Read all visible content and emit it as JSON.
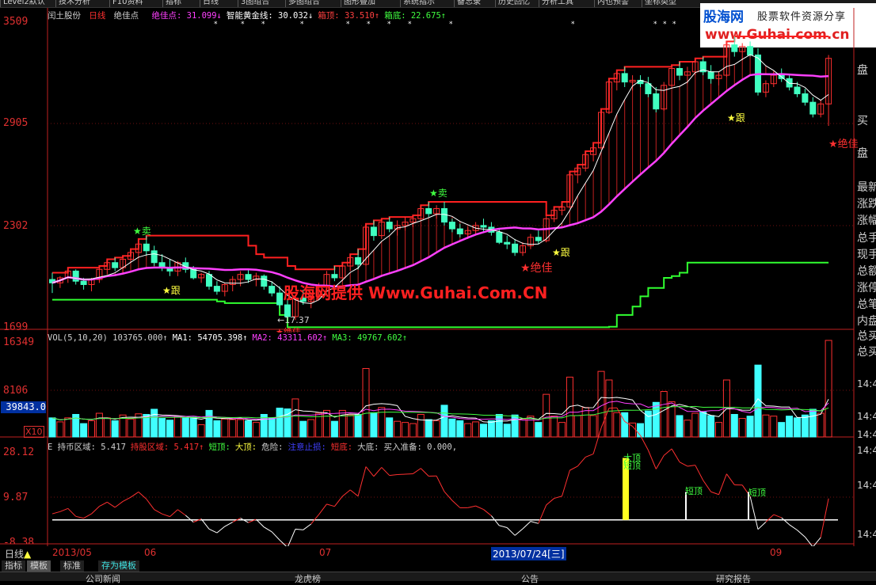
{
  "menubar": {
    "items": [
      "Level2默认",
      "技术分析",
      "F10资料",
      "指标",
      "日线",
      "3图组合",
      "多图组合",
      "图形叠加",
      "系统指示",
      "备忘录",
      "历史回忆",
      "分析工具",
      "内也预警",
      "坐标类型"
    ]
  },
  "logo": {
    "brand": "股海网",
    "slogan": "股票软件资源分享",
    "url": "www.Guhai.com.cn"
  },
  "watermark": "股海网提供 Www.Guhai.Com.CN",
  "stock": {
    "name": "闰土股份",
    "period": "日线",
    "indicator": "绝佳点"
  },
  "main_legend": [
    {
      "text": "绝佳点: 31.099↓",
      "color": "#ff40ff"
    },
    {
      "text": "智能黄金线: 30.032↓",
      "color": "#ffffff"
    },
    {
      "text": "箱顶: 33.510↑",
      "color": "#ff4040"
    },
    {
      "text": "箱底: 22.675↑",
      "color": "#40ff40"
    }
  ],
  "price_axis": [
    "3509",
    "2905",
    "2302",
    "1699"
  ],
  "price_low_label": "←17.37",
  "signals": [
    {
      "text": "★卖",
      "color": "#40ff40"
    },
    {
      "text": "★跟",
      "color": "#ffff40"
    },
    {
      "text": "★卖",
      "color": "#40ff40"
    },
    {
      "text": "★跟",
      "color": "#ffff40"
    },
    {
      "text": "★绝佳",
      "color": "#ff3030"
    },
    {
      "text": "★跟",
      "color": "#ffff40"
    },
    {
      "text": "★绝佳",
      "color": "#ff3030"
    },
    {
      "text": "★绝佳",
      "color": "#ff3030"
    }
  ],
  "volume": {
    "legend": [
      {
        "text": "VOL(5,10,20) 103765.000↑",
        "color": "#d0d0d0"
      },
      {
        "text": "MA1: 54705.398↑",
        "color": "#ffffff"
      },
      {
        "text": "MA2: 43311.602↑",
        "color": "#ff40ff"
      },
      {
        "text": "MA3: 49767.602↑",
        "color": "#40ff40"
      }
    ],
    "axis": [
      "16349",
      "8106"
    ],
    "current": "39843.0",
    "unit": "X10"
  },
  "lower": {
    "legend": [
      {
        "text": "E 持币区域: 5.417",
        "color": "#d0d0d0"
      },
      {
        "text": "持股区域: 5.417↑",
        "color": "#ff3030"
      },
      {
        "text": "短顶:",
        "color": "#40ff40"
      },
      {
        "text": "大顶:",
        "color": "#ffff40"
      },
      {
        "text": "危险:",
        "color": "#d0d0d0"
      },
      {
        "text": "注意止损:",
        "color": "#4040ff"
      },
      {
        "text": "短底:",
        "color": "#ff3030"
      },
      {
        "text": "大底:",
        "color": "#d0d0d0"
      },
      {
        "text": "买入准备: 0.000,",
        "color": "#d0d0d0"
      }
    ],
    "axis": [
      "28.12",
      "9.87",
      "-8.38"
    ],
    "top_labels": [
      "大顶",
      "短顶",
      "短顶",
      "短顶"
    ]
  },
  "right_panel": [
    "盘",
    "买",
    "盘",
    "最新",
    "涨跌",
    "涨幅",
    "总手",
    "现手",
    "总额",
    "涨停",
    "总笔",
    "内盘",
    "总买",
    "总买"
  ],
  "right_times": [
    "14:4",
    "14:4",
    "14:4",
    "14:4",
    "14:4",
    "14:4"
  ],
  "dates": [
    "2013/05",
    "06",
    "07",
    "09"
  ],
  "cursor_date": "2013/07/24[三]",
  "period_label": "日线",
  "tabs": [
    "指标",
    "模板",
    "标准",
    "存为模板"
  ],
  "bottom": [
    "公司新闻",
    "龙虎榜",
    "公告",
    "研究报告"
  ],
  "chart_data": {
    "type": "candlestick",
    "y_range": [
      16.99,
      35.09
    ],
    "candles": [
      [
        19.8,
        20.2,
        19.0,
        19.6
      ],
      [
        19.6,
        20.0,
        19.3,
        19.9
      ],
      [
        19.9,
        20.5,
        19.6,
        20.3
      ],
      [
        20.3,
        20.4,
        19.5,
        19.7
      ],
      [
        19.7,
        19.9,
        19.2,
        19.5
      ],
      [
        19.5,
        19.9,
        19.1,
        19.8
      ],
      [
        19.8,
        20.6,
        19.6,
        20.4
      ],
      [
        20.4,
        21.0,
        20.1,
        20.8
      ],
      [
        20.8,
        21.1,
        20.3,
        20.5
      ],
      [
        20.5,
        21.2,
        20.2,
        21.0
      ],
      [
        21.0,
        21.6,
        20.8,
        21.4
      ],
      [
        21.4,
        22.2,
        21.1,
        21.9
      ],
      [
        21.9,
        22.4,
        21.2,
        21.5
      ],
      [
        21.5,
        21.8,
        20.6,
        20.8
      ],
      [
        20.8,
        21.3,
        20.3,
        20.5
      ],
      [
        20.5,
        21.0,
        20.0,
        20.3
      ],
      [
        20.3,
        20.9,
        20.0,
        20.8
      ],
      [
        20.8,
        21.1,
        20.2,
        20.4
      ],
      [
        20.4,
        20.6,
        19.8,
        19.9
      ],
      [
        19.9,
        20.2,
        19.6,
        20.1
      ],
      [
        20.1,
        20.3,
        19.2,
        19.4
      ],
      [
        19.4,
        19.7,
        18.9,
        19.1
      ],
      [
        19.1,
        19.6,
        18.8,
        19.5
      ],
      [
        19.5,
        20.0,
        19.1,
        19.8
      ],
      [
        19.8,
        20.3,
        19.4,
        20.1
      ],
      [
        20.1,
        20.4,
        19.6,
        19.8
      ],
      [
        19.8,
        20.2,
        19.4,
        20.0
      ],
      [
        20.0,
        20.1,
        19.2,
        19.4
      ],
      [
        19.4,
        19.7,
        18.8,
        19.0
      ],
      [
        19.0,
        19.4,
        18.1,
        18.3
      ],
      [
        18.3,
        18.6,
        17.37,
        17.6
      ],
      [
        17.6,
        18.9,
        17.4,
        18.7
      ],
      [
        18.7,
        19.2,
        18.3,
        18.5
      ],
      [
        18.5,
        19.0,
        18.1,
        18.8
      ],
      [
        18.8,
        19.6,
        18.6,
        19.4
      ],
      [
        19.4,
        20.3,
        19.2,
        20.1
      ],
      [
        20.1,
        20.6,
        19.7,
        19.9
      ],
      [
        19.9,
        20.8,
        19.7,
        20.6
      ],
      [
        20.6,
        21.3,
        20.3,
        21.1
      ],
      [
        21.1,
        21.6,
        20.4,
        20.7
      ],
      [
        20.7,
        23.1,
        20.6,
        22.9
      ],
      [
        22.9,
        23.3,
        22.1,
        22.4
      ],
      [
        22.4,
        23.4,
        22.2,
        23.2
      ],
      [
        23.2,
        23.5,
        22.6,
        22.8
      ],
      [
        22.8,
        23.3,
        22.4,
        23.0
      ],
      [
        23.0,
        23.5,
        22.7,
        23.2
      ],
      [
        23.2,
        23.6,
        22.9,
        23.4
      ],
      [
        23.4,
        24.2,
        23.3,
        24.0
      ],
      [
        24.0,
        24.4,
        23.5,
        23.7
      ],
      [
        23.7,
        24.2,
        23.4,
        24.0
      ],
      [
        24.0,
        24.4,
        23.0,
        23.2
      ],
      [
        23.2,
        23.4,
        22.6,
        22.8
      ],
      [
        22.8,
        23.1,
        22.3,
        22.5
      ],
      [
        22.5,
        22.9,
        22.2,
        22.7
      ],
      [
        22.7,
        23.2,
        22.5,
        23.0
      ],
      [
        23.0,
        23.4,
        22.6,
        22.9
      ],
      [
        22.9,
        23.2,
        22.4,
        22.6
      ],
      [
        22.6,
        22.8,
        21.9,
        22.0
      ],
      [
        22.0,
        22.4,
        21.6,
        21.9
      ],
      [
        21.9,
        22.2,
        21.2,
        21.4
      ],
      [
        21.4,
        22.0,
        21.2,
        21.8
      ],
      [
        21.8,
        22.5,
        21.6,
        22.3
      ],
      [
        22.3,
        22.7,
        21.9,
        22.1
      ],
      [
        22.1,
        23.6,
        22.0,
        23.4
      ],
      [
        23.4,
        24.1,
        23.2,
        23.9
      ],
      [
        23.9,
        24.4,
        23.6,
        24.1
      ],
      [
        24.1,
        26.2,
        24.0,
        26.0
      ],
      [
        26.0,
        26.6,
        25.5,
        26.4
      ],
      [
        26.4,
        27.4,
        26.2,
        27.2
      ],
      [
        27.2,
        27.9,
        26.8,
        27.6
      ],
      [
        27.6,
        29.9,
        27.5,
        29.7
      ],
      [
        29.7,
        31.7,
        29.6,
        31.5
      ],
      [
        31.5,
        32.2,
        31.0,
        32.0
      ],
      [
        32.0,
        32.4,
        31.2,
        31.5
      ],
      [
        31.5,
        31.9,
        31.0,
        31.6
      ],
      [
        31.6,
        31.9,
        31.2,
        31.4
      ],
      [
        31.4,
        31.8,
        30.6,
        30.8
      ],
      [
        30.8,
        31.2,
        29.7,
        29.9
      ],
      [
        29.9,
        31.5,
        29.8,
        31.3
      ],
      [
        31.3,
        32.5,
        31.1,
        32.3
      ],
      [
        32.3,
        32.7,
        31.6,
        31.9
      ],
      [
        31.9,
        32.4,
        31.4,
        32.1
      ],
      [
        32.1,
        32.9,
        31.9,
        32.7
      ],
      [
        32.7,
        33.0,
        31.9,
        32.1
      ],
      [
        32.1,
        32.5,
        31.4,
        31.7
      ],
      [
        31.7,
        32.1,
        31.3,
        31.9
      ],
      [
        31.9,
        33.9,
        31.8,
        33.7
      ],
      [
        33.7,
        34.2,
        33.0,
        33.3
      ],
      [
        33.3,
        33.8,
        32.8,
        33.6
      ],
      [
        33.6,
        33.9,
        33.0,
        33.1
      ],
      [
        33.1,
        33.5,
        30.7,
        30.9
      ],
      [
        30.9,
        31.6,
        30.6,
        31.4
      ],
      [
        31.4,
        32.1,
        31.2,
        31.9
      ],
      [
        31.9,
        32.3,
        31.5,
        31.7
      ],
      [
        31.7,
        31.9,
        31.0,
        31.2
      ],
      [
        31.2,
        31.5,
        30.6,
        30.8
      ],
      [
        30.8,
        31.1,
        30.1,
        30.3
      ],
      [
        30.3,
        30.6,
        29.4,
        29.6
      ],
      [
        29.6,
        30.4,
        29.4,
        30.2
      ],
      [
        30.2,
        33.1,
        28.9,
        32.9
      ]
    ]
  }
}
